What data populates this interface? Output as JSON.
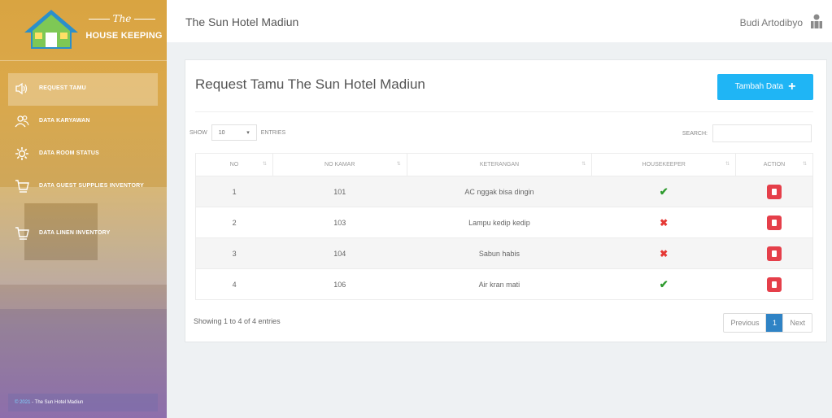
{
  "brand": {
    "script": "The",
    "name": "HOUSE KEEPING"
  },
  "sidebar": {
    "items": [
      {
        "label": "REQUEST TAMU",
        "icon": "speaker-icon",
        "active": true
      },
      {
        "label": "DATA KARYAWAN",
        "icon": "users-icon",
        "active": false
      },
      {
        "label": "DATA ROOM STATUS",
        "icon": "gear-icon",
        "active": false
      },
      {
        "label": "DATA GUEST SUPPLIES INVENTORY",
        "icon": "cart-icon",
        "active": false
      },
      {
        "label": "DATA LINEN INVENTORY",
        "icon": "cart-icon",
        "active": false
      }
    ],
    "footer_prefix": "© 2021",
    "footer_text": "- The Sun Hotel Madiun"
  },
  "header": {
    "title": "The Sun Hotel Madiun",
    "user_name": "Budi Artodibyo",
    "user_icon": "user-icon"
  },
  "panel": {
    "title": "Request Tamu The Sun Hotel Madiun",
    "add_button": "Tambah Data",
    "show_label": "SHOW",
    "entries_value": "10",
    "entries_label": "ENTRIES",
    "search_label": "SEARCH:",
    "search_value": ""
  },
  "table": {
    "columns": [
      "NO",
      "NO KAMAR",
      "KETERANGAN",
      "HOUSEKEEPER",
      "ACTION"
    ],
    "rows": [
      {
        "no": "1",
        "kamar": "101",
        "keterangan": "AC nggak bisa dingin",
        "housekeeper": "check"
      },
      {
        "no": "2",
        "kamar": "103",
        "keterangan": "Lampu kedip kedip",
        "housekeeper": "cross"
      },
      {
        "no": "3",
        "kamar": "104",
        "keterangan": "Sabun habis",
        "housekeeper": "cross"
      },
      {
        "no": "4",
        "kamar": "106",
        "keterangan": "Air kran mati",
        "housekeeper": "check"
      }
    ]
  },
  "footer": {
    "showing": "Showing 1 to 4 of 4 entries",
    "prev": "Previous",
    "page": "1",
    "next": "Next"
  },
  "colors": {
    "accent": "#1fb5f5",
    "danger": "#e53f4a",
    "success": "#2e9b2e",
    "pager_active": "#2f83c5"
  }
}
